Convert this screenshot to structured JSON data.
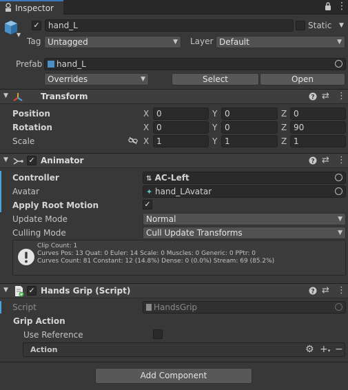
{
  "tab": {
    "title": "Inspector",
    "lock_icon": "lock-icon",
    "menu_icon": "more-icon"
  },
  "object": {
    "active": true,
    "name": "hand_L",
    "static_label": "Static",
    "static_checked": false,
    "tag_label": "Tag",
    "tag_value": "Untagged",
    "layer_label": "Layer",
    "layer_value": "Default",
    "prefab_label": "Prefab",
    "prefab_value": "hand_L",
    "overrides_label": "Overrides",
    "select_label": "Select",
    "open_label": "Open"
  },
  "transform": {
    "title": "Transform",
    "position_label": "Position",
    "rotation_label": "Rotation",
    "scale_label": "Scale",
    "axis_x": "X",
    "axis_y": "Y",
    "axis_z": "Z",
    "position": {
      "x": "0",
      "y": "0",
      "z": "0"
    },
    "rotation": {
      "x": "0",
      "y": "0",
      "z": "90"
    },
    "scale": {
      "x": "1",
      "y": "1",
      "z": "1"
    }
  },
  "animator": {
    "title": "Animator",
    "enabled": true,
    "controller_label": "Controller",
    "controller_value": "AC-Left",
    "avatar_label": "Avatar",
    "avatar_value": "hand_LAvatar",
    "apply_root_motion_label": "Apply Root Motion",
    "apply_root_motion": true,
    "update_mode_label": "Update Mode",
    "update_mode_value": "Normal",
    "culling_mode_label": "Culling Mode",
    "culling_mode_value": "Cull Update Transforms",
    "info_line1": "Clip Count: 1",
    "info_line2": "Curves Pos: 13 Quat: 0 Euler: 14 Scale: 0 Muscles: 0 Generic: 0 PPtr: 0",
    "info_line3": "Curves Count: 81 Constant: 12 (14.8%) Dense: 0 (0.0%) Stream: 69 (85.2%)"
  },
  "hands_grip": {
    "title": "Hands Grip (Script)",
    "enabled": true,
    "script_label": "Script",
    "script_value": "HandsGrip",
    "grip_action_label": "Grip Action",
    "use_reference_label": "Use Reference",
    "use_reference": false,
    "action_label": "Action"
  },
  "add_component_label": "Add Component",
  "colors": {
    "background": "#383838",
    "field": "#2a2a2a",
    "header": "#3e3e3e",
    "accent_blue": "#4aa3df"
  }
}
